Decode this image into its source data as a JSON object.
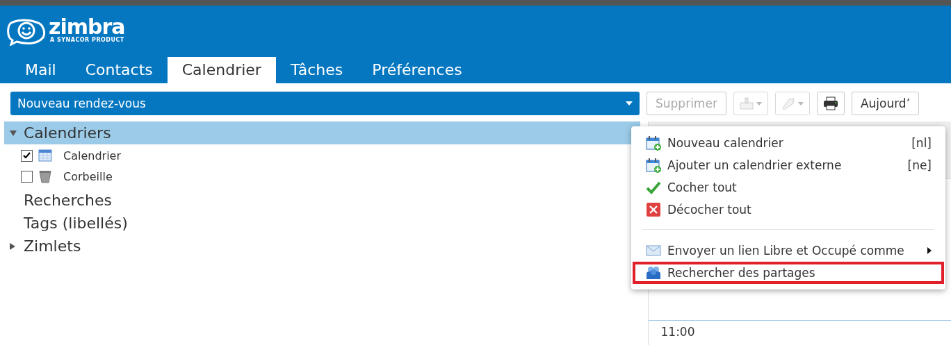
{
  "logo": {
    "wordmark": "zimbra",
    "tagline": "A SYNACOR PRODUCT"
  },
  "tabs": [
    {
      "label": "Mail",
      "selected": false
    },
    {
      "label": "Contacts",
      "selected": false
    },
    {
      "label": "Calendrier",
      "selected": true
    },
    {
      "label": "Tâches",
      "selected": false
    },
    {
      "label": "Préférences",
      "selected": false
    }
  ],
  "toolbar": {
    "new_button": "Nouveau rendez-vous",
    "buttons": [
      {
        "kind": "text",
        "label": "Supprimer",
        "disabled": true
      },
      {
        "kind": "move",
        "disabled": true
      },
      {
        "kind": "tag",
        "disabled": true
      },
      {
        "kind": "print",
        "disabled": false
      },
      {
        "kind": "text",
        "label": "Aujourd’",
        "disabled": false
      }
    ]
  },
  "sidebar": {
    "sections": [
      {
        "label": "Calendriers",
        "expanded": true,
        "selected": true,
        "items": [
          {
            "label": "Calendrier",
            "kind": "calendar",
            "checked": true
          },
          {
            "label": "Corbeille",
            "kind": "trash",
            "checked": false
          }
        ]
      },
      {
        "label": "Recherches",
        "selected": false
      },
      {
        "label": "Tags (libellés)",
        "selected": false
      },
      {
        "label": "Zimlets",
        "expanded": false,
        "selected": false
      }
    ]
  },
  "calendar": {
    "times": [
      "11:00"
    ]
  },
  "context_menu": {
    "items": [
      {
        "kind": "item",
        "label": "Nouveau calendrier",
        "shortcut": "[nl]",
        "highlighted": false
      },
      {
        "kind": "item",
        "label": "Ajouter un calendrier externe",
        "shortcut": "[ne]",
        "highlighted": false
      },
      {
        "kind": "item",
        "label": "Cocher tout",
        "highlighted": false
      },
      {
        "kind": "item",
        "label": "Décocher tout",
        "highlighted": false
      },
      {
        "kind": "separator"
      },
      {
        "kind": "submenu",
        "label": "Envoyer un lien Libre et Occupé comme",
        "highlighted": false
      },
      {
        "kind": "item",
        "label": "Rechercher des partages",
        "highlighted": true
      }
    ]
  }
}
